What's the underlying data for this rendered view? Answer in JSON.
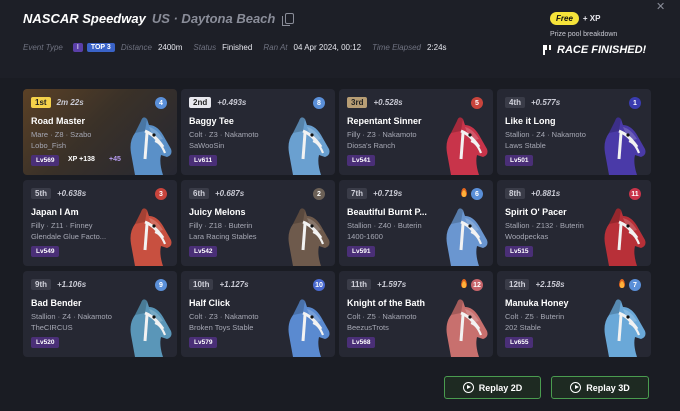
{
  "header": {
    "race_name": "NASCAR Speedway",
    "location": "US · Daytona Beach",
    "free_badge": "Free",
    "xp_label": "+ XP",
    "prize_link": "Prize pool breakdown",
    "close_icon": "close-icon"
  },
  "meta": {
    "event_type_label": "Event Type",
    "event_type_value": "I",
    "top_tag": "TOP 3",
    "distance_label": "Distance",
    "distance_value": "2400m",
    "status_label": "Status",
    "status_value": "Finished",
    "ran_at_label": "Ran At",
    "ran_at_value": "04 Apr 2024, 00:12",
    "elapsed_label": "Time Elapsed",
    "elapsed_value": "2:24s",
    "race_finished": "RACE FINISHED!"
  },
  "results": [
    {
      "position": "1st",
      "gap": "2m 22s",
      "number": "4",
      "num_color": "#5a8fd8",
      "name": "Road Master",
      "info": "Mare · Z8 · Szabo",
      "owner": "Lobo_Fish",
      "level": "Lv569",
      "xp": "XP +138",
      "xp_bonus": "+45",
      "horse_color": "#5a90c8",
      "fire": false
    },
    {
      "position": "2nd",
      "gap": "+0.493s",
      "number": "8",
      "num_color": "#5a8fd8",
      "name": "Baggy Tee",
      "info": "Colt · Z3 · Nakamoto",
      "owner": "SaWooSin",
      "level": "Lv611",
      "horse_color": "#6aa0d0",
      "fire": false
    },
    {
      "position": "3rd",
      "gap": "+0.528s",
      "number": "5",
      "num_color": "#c8443c",
      "name": "Repentant Sinner",
      "info": "Filly · Z3 · Nakamoto",
      "owner": "Diosa's Ranch",
      "level": "Lv541",
      "horse_color": "#c8344a",
      "fire": false
    },
    {
      "position": "4th",
      "gap": "+0.577s",
      "number": "1",
      "num_color": "#3a3cb0",
      "name": "Like it Long",
      "info": "Stallion · Z4 · Nakamoto",
      "owner": "Laws Stable",
      "level": "Lv501",
      "horse_color": "#4a3aa8",
      "fire": false
    },
    {
      "position": "5th",
      "gap": "+0.638s",
      "number": "3",
      "num_color": "#c8443c",
      "name": "Japan I Am",
      "info": "Filly · Z11 · Finney",
      "owner": "Glendale Glue Facto...",
      "level": "Lv549",
      "horse_color": "#c85040",
      "fire": false
    },
    {
      "position": "6th",
      "gap": "+0.687s",
      "number": "2",
      "num_color": "#6b6056",
      "name": "Juicy Melons",
      "info": "Filly · Z18 · Buterin",
      "owner": "Lara Racing Stables",
      "level": "Lv542",
      "horse_color": "#6e5a4c",
      "fire": false
    },
    {
      "position": "7th",
      "gap": "+0.719s",
      "number": "6",
      "num_color": "#5a8fd8",
      "name": "Beautiful Burnt P...",
      "info": "Stallion · Z40 · Buterin",
      "owner": "1400-1600",
      "level": "Lv591",
      "horse_color": "#6a96d0",
      "fire": true
    },
    {
      "position": "8th",
      "gap": "+0.881s",
      "number": "11",
      "num_color": "#c8344a",
      "name": "Spirit O' Pacer",
      "info": "Stallion · Z132 · Buterin",
      "owner": "Woodpeckas",
      "level": "Lv515",
      "horse_color": "#b83038",
      "fire": false
    },
    {
      "position": "9th",
      "gap": "+1.106s",
      "number": "9",
      "num_color": "#5a8fd8",
      "name": "Bad Bender",
      "info": "Stallion · Z4 · Nakamoto",
      "owner": "TheCIRCUS",
      "level": "Lv520",
      "horse_color": "#5a96b8",
      "fire": false
    },
    {
      "position": "10th",
      "gap": "+1.127s",
      "number": "10",
      "num_color": "#4a6ad0",
      "name": "Half Click",
      "info": "Colt · Z3 · Nakamoto",
      "owner": "Broken Toys Stable",
      "level": "Lv579",
      "horse_color": "#5a8ad0",
      "fire": false
    },
    {
      "position": "11th",
      "gap": "+1.597s",
      "number": "12",
      "num_color": "#c8646a",
      "name": "Knight of the Bath",
      "info": "Colt · Z5 · Nakamoto",
      "owner": "BeezusTrots",
      "level": "Lv568",
      "horse_color": "#c8706e",
      "fire": true
    },
    {
      "position": "12th",
      "gap": "+2.158s",
      "number": "7",
      "num_color": "#5a8fd8",
      "name": "Manuka Honey",
      "info": "Colt · Z5 · Buterin",
      "owner": "202 Stable",
      "level": "Lv655",
      "horse_color": "#6aa8d8",
      "fire": true
    }
  ],
  "buttons": {
    "replay_2d": "Replay 2D",
    "replay_3d": "Replay 3D"
  }
}
